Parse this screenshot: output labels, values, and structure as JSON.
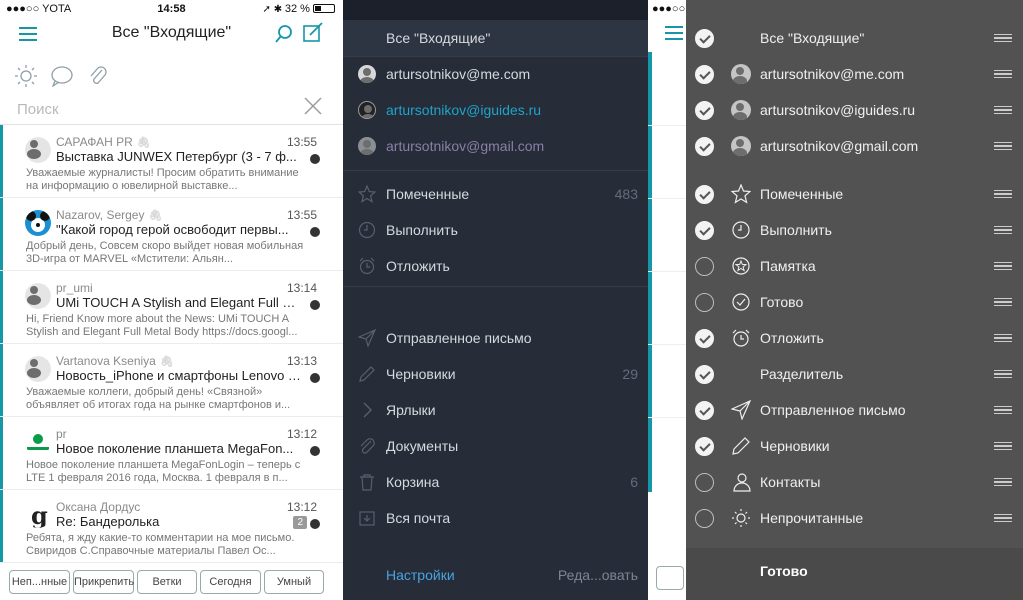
{
  "status": {
    "carrier": "●●●○○ YOTA",
    "time": "14:58",
    "battery": "32 %"
  },
  "inbox": {
    "title": "Все \"Входящие\"",
    "search_placeholder": "Поиск",
    "mails": [
      {
        "from": "САРАФАН PR",
        "time": "13:55",
        "subject": "Выставка JUNWEX Петербург (3 - 7 ф...",
        "preview": "Уважаемые журналисты! Просим обратить внимание на информацию о ювелирной выставке...",
        "attach": true
      },
      {
        "from": "Nazarov, Sergey",
        "time": "13:55",
        "subject": "\"Какой город герой освободит первы...",
        "preview": "Добрый день, Совсем скоро выйдет новая мобильная 3D-игра от MARVEL «Мстители: Альян...",
        "attach": true
      },
      {
        "from": "pr_umi",
        "time": "13:14",
        "subject": "UMi TOUCH A Stylish and Elegant Full M...",
        "preview": "Hi, Friend Know more about the News: UMi TOUCH A Stylish and Elegant Full Metal Body https://docs.googl...",
        "attach": false
      },
      {
        "from": "Vartanova Kseniya",
        "time": "13:13",
        "subject": "Новость_iPhone и смартфоны Lenovo с...",
        "preview": "Уважаемые коллеги, добрый день! «Связной» объявляет об итогах года на рынке смартфонов и...",
        "attach": true
      },
      {
        "from": "pr",
        "time": "13:12",
        "subject": "Новое поколение планшета MegaFon...",
        "preview": "Новое поколение планшета MegaFonLogin – теперь с LTE 1 февраля 2016 года, Москва. 1 февраля в п...",
        "attach": false
      },
      {
        "from": "Оксана Дордус",
        "time": "13:12",
        "subject": "Re: Бандеролька",
        "preview": "Ребята, я жду какие-то комментарии на мое письмо. Свиридов С.Справочные материалы Павел Ос...",
        "attach": false,
        "count": "2"
      }
    ],
    "tabs": [
      "Неп...нные",
      "Прикрепить",
      "Ветки",
      "Сегодня",
      "Умный"
    ]
  },
  "menu": {
    "header": "Все \"Входящие\"",
    "accounts": [
      "artursotnikov@me.com",
      "artursotnikov@iguides.ru",
      "artursotnikov@gmail.com"
    ],
    "items": [
      {
        "label": "Помеченные",
        "count": "483",
        "icon": "star-icon"
      },
      {
        "label": "Выполнить",
        "count": "",
        "icon": "clock-icon"
      },
      {
        "label": "Отложить",
        "count": "",
        "icon": "alarm-icon"
      },
      {
        "label": "Отправленное письмо",
        "count": "",
        "icon": "send-icon"
      },
      {
        "label": "Черновики",
        "count": "29",
        "icon": "pencil-icon"
      },
      {
        "label": "Ярлыки",
        "count": "",
        "icon": "chevron-right-icon"
      },
      {
        "label": "Документы",
        "count": "",
        "icon": "paperclip-icon"
      },
      {
        "label": "Корзина",
        "count": "6",
        "icon": "trash-icon"
      },
      {
        "label": "Вся почта",
        "count": "",
        "icon": "archive-icon"
      }
    ],
    "settings": "Настройки",
    "edit": "Реда...овать",
    "colors": {
      "accent": "#1597a7",
      "link": "#4aa3e0"
    }
  },
  "edit": {
    "items": [
      {
        "label": "Все \"Входящие\"",
        "checked": true
      },
      {
        "label": "artursotnikov@me.com",
        "checked": true
      },
      {
        "label": "artursotnikov@iguides.ru",
        "checked": true
      },
      {
        "label": "artursotnikov@gmail.com",
        "checked": true
      },
      {
        "label": "Помеченные",
        "checked": true
      },
      {
        "label": "Выполнить",
        "checked": true
      },
      {
        "label": "Памятка",
        "checked": false
      },
      {
        "label": "Готово",
        "checked": false
      },
      {
        "label": "Отложить",
        "checked": true
      },
      {
        "label": "Разделитель",
        "checked": true
      },
      {
        "label": "Отправленное письмо",
        "checked": true
      },
      {
        "label": "Черновики",
        "checked": true
      },
      {
        "label": "Контакты",
        "checked": false
      },
      {
        "label": "Непрочитанные",
        "checked": false
      }
    ],
    "done": "Готово"
  }
}
